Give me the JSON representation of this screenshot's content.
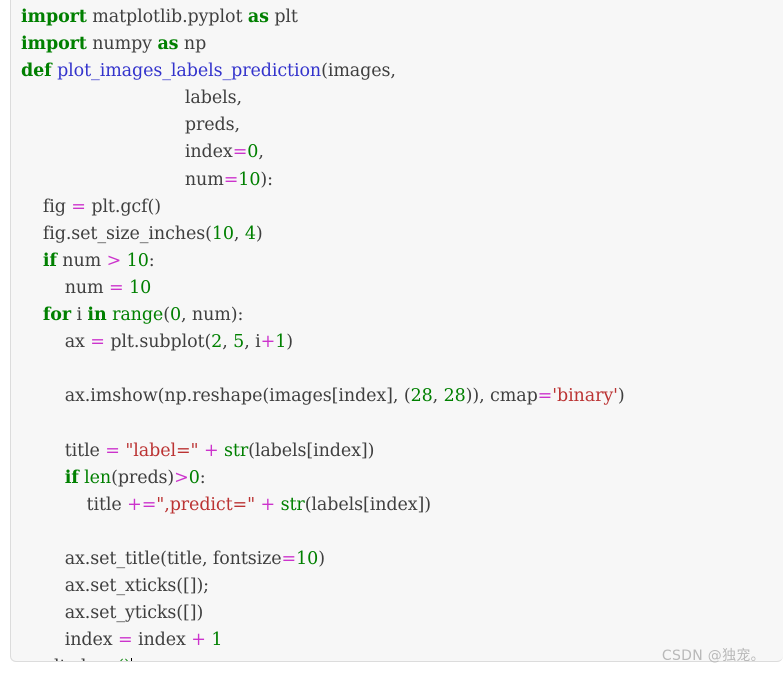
{
  "editor": {
    "language": "python",
    "background_color": "#f7f7f7",
    "border_color": "#dcdcdc",
    "default_text_color": "#3f3f3f",
    "syntax_colors": {
      "keyword": "#008000",
      "builtin": "#008000",
      "function_name": "#3333cc",
      "number": "#008000",
      "string": "#bb3333",
      "operator": "#cc33cc",
      "plain": "#3f3f3f"
    },
    "lines": [
      {
        "indent": 0,
        "tokens": [
          {
            "t": "import",
            "c": "kw"
          },
          {
            "t": " matplotlib.pyplot ",
            "c": "pl"
          },
          {
            "t": "as",
            "c": "kw"
          },
          {
            "t": " plt",
            "c": "pl"
          }
        ]
      },
      {
        "indent": 0,
        "tokens": [
          {
            "t": "import",
            "c": "kw"
          },
          {
            "t": " numpy ",
            "c": "pl"
          },
          {
            "t": "as",
            "c": "kw"
          },
          {
            "t": " np",
            "c": "pl"
          }
        ]
      },
      {
        "indent": 0,
        "tokens": [
          {
            "t": "def",
            "c": "kw"
          },
          {
            "t": " ",
            "c": "pl"
          },
          {
            "t": "plot_images_labels_prediction",
            "c": "fn"
          },
          {
            "t": "(images,",
            "c": "pl"
          }
        ]
      },
      {
        "indent": 0,
        "tokens": [
          {
            "t": "                              labels,",
            "c": "pl"
          }
        ]
      },
      {
        "indent": 0,
        "tokens": [
          {
            "t": "                              preds,",
            "c": "pl"
          }
        ]
      },
      {
        "indent": 0,
        "tokens": [
          {
            "t": "                              index",
            "c": "pl"
          },
          {
            "t": "=",
            "c": "op"
          },
          {
            "t": "0",
            "c": "num"
          },
          {
            "t": ",",
            "c": "pl"
          }
        ]
      },
      {
        "indent": 0,
        "tokens": [
          {
            "t": "                              num",
            "c": "pl"
          },
          {
            "t": "=",
            "c": "op"
          },
          {
            "t": "10",
            "c": "num"
          },
          {
            "t": "):",
            "c": "pl"
          }
        ]
      },
      {
        "indent": 0,
        "tokens": [
          {
            "t": "    fig ",
            "c": "pl"
          },
          {
            "t": "=",
            "c": "op"
          },
          {
            "t": " plt.gcf()",
            "c": "pl"
          }
        ]
      },
      {
        "indent": 0,
        "tokens": [
          {
            "t": "    fig.set_size_inches(",
            "c": "pl"
          },
          {
            "t": "10",
            "c": "num"
          },
          {
            "t": ", ",
            "c": "pl"
          },
          {
            "t": "4",
            "c": "num"
          },
          {
            "t": ")",
            "c": "pl"
          }
        ]
      },
      {
        "indent": 0,
        "tokens": [
          {
            "t": "    ",
            "c": "pl"
          },
          {
            "t": "if",
            "c": "kw"
          },
          {
            "t": " num ",
            "c": "pl"
          },
          {
            "t": ">",
            "c": "op"
          },
          {
            "t": " ",
            "c": "pl"
          },
          {
            "t": "10",
            "c": "num"
          },
          {
            "t": ":",
            "c": "pl"
          }
        ]
      },
      {
        "indent": 0,
        "tokens": [
          {
            "t": "        num ",
            "c": "pl"
          },
          {
            "t": "=",
            "c": "op"
          },
          {
            "t": " ",
            "c": "pl"
          },
          {
            "t": "10",
            "c": "num"
          }
        ]
      },
      {
        "indent": 0,
        "tokens": [
          {
            "t": "    ",
            "c": "pl"
          },
          {
            "t": "for",
            "c": "kw"
          },
          {
            "t": " i ",
            "c": "pl"
          },
          {
            "t": "in",
            "c": "kw"
          },
          {
            "t": " ",
            "c": "pl"
          },
          {
            "t": "range",
            "c": "bi"
          },
          {
            "t": "(",
            "c": "pl"
          },
          {
            "t": "0",
            "c": "num"
          },
          {
            "t": ", num):",
            "c": "pl"
          }
        ]
      },
      {
        "indent": 0,
        "tokens": [
          {
            "t": "        ax ",
            "c": "pl"
          },
          {
            "t": "=",
            "c": "op"
          },
          {
            "t": " plt.subplot(",
            "c": "pl"
          },
          {
            "t": "2",
            "c": "num"
          },
          {
            "t": ", ",
            "c": "pl"
          },
          {
            "t": "5",
            "c": "num"
          },
          {
            "t": ", i",
            "c": "pl"
          },
          {
            "t": "+",
            "c": "op"
          },
          {
            "t": "1",
            "c": "num"
          },
          {
            "t": ")",
            "c": "pl"
          }
        ]
      },
      {
        "indent": 0,
        "tokens": []
      },
      {
        "indent": 0,
        "tokens": [
          {
            "t": "        ax.imshow(np.reshape(images[index], (",
            "c": "pl"
          },
          {
            "t": "28",
            "c": "num"
          },
          {
            "t": ", ",
            "c": "pl"
          },
          {
            "t": "28",
            "c": "num"
          },
          {
            "t": ")), cmap",
            "c": "pl"
          },
          {
            "t": "=",
            "c": "op"
          },
          {
            "t": "'binary'",
            "c": "str"
          },
          {
            "t": ")",
            "c": "pl"
          }
        ]
      },
      {
        "indent": 0,
        "tokens": []
      },
      {
        "indent": 0,
        "tokens": [
          {
            "t": "        title ",
            "c": "pl"
          },
          {
            "t": "=",
            "c": "op"
          },
          {
            "t": " ",
            "c": "pl"
          },
          {
            "t": "\"label=\"",
            "c": "str"
          },
          {
            "t": " ",
            "c": "pl"
          },
          {
            "t": "+",
            "c": "op"
          },
          {
            "t": " ",
            "c": "pl"
          },
          {
            "t": "str",
            "c": "bi"
          },
          {
            "t": "(labels[index])",
            "c": "pl"
          }
        ]
      },
      {
        "indent": 0,
        "tokens": [
          {
            "t": "        ",
            "c": "pl"
          },
          {
            "t": "if",
            "c": "kw"
          },
          {
            "t": " ",
            "c": "pl"
          },
          {
            "t": "len",
            "c": "bi"
          },
          {
            "t": "(preds)",
            "c": "pl"
          },
          {
            "t": ">",
            "c": "op"
          },
          {
            "t": "0",
            "c": "num"
          },
          {
            "t": ":",
            "c": "pl"
          }
        ]
      },
      {
        "indent": 0,
        "tokens": [
          {
            "t": "            title ",
            "c": "pl"
          },
          {
            "t": "+=",
            "c": "op"
          },
          {
            "t": "\",predict=\"",
            "c": "str"
          },
          {
            "t": " ",
            "c": "pl"
          },
          {
            "t": "+",
            "c": "op"
          },
          {
            "t": " ",
            "c": "pl"
          },
          {
            "t": "str",
            "c": "bi"
          },
          {
            "t": "(labels[index])",
            "c": "pl"
          }
        ]
      },
      {
        "indent": 0,
        "tokens": []
      },
      {
        "indent": 0,
        "tokens": [
          {
            "t": "        ax.set_title(title, fontsize",
            "c": "pl"
          },
          {
            "t": "=",
            "c": "op"
          },
          {
            "t": "10",
            "c": "num"
          },
          {
            "t": ")",
            "c": "pl"
          }
        ]
      },
      {
        "indent": 0,
        "tokens": [
          {
            "t": "        ax.set_xticks([]);",
            "c": "pl"
          }
        ]
      },
      {
        "indent": 0,
        "tokens": [
          {
            "t": "        ax.set_yticks([])",
            "c": "pl"
          }
        ]
      },
      {
        "indent": 0,
        "tokens": [
          {
            "t": "        index ",
            "c": "pl"
          },
          {
            "t": "=",
            "c": "op"
          },
          {
            "t": " index ",
            "c": "pl"
          },
          {
            "t": "+",
            "c": "op"
          },
          {
            "t": " ",
            "c": "pl"
          },
          {
            "t": "1",
            "c": "num"
          }
        ]
      },
      {
        "indent": 0,
        "tokens": [
          {
            "t": "    plt.show",
            "c": "pl"
          },
          {
            "t": "()",
            "c": "bi"
          },
          {
            "t": "",
            "c": "cursor"
          }
        ]
      }
    ],
    "plain_text": "import matplotlib.pyplot as plt\nimport numpy as np\ndef plot_images_labels_prediction(images,\n                              labels,\n                              preds,\n                              index=0,\n                              num=10):\n    fig = plt.gcf()\n    fig.set_size_inches(10,4)\n    if num > 10:\n        num = 10\n    for i in range(0,num):\n        ax = plt.subplot(2,5,i+1)\n\n        ax.imshow(np.reshape(images[index],(28,28)),cmap='binary')\n\n        title = \"label=\" + str(labels[index])\n        if len(preds)>0:\n            title +=\",predict=\" + str(labels[index])\n\n        ax.set_title(title,fontsize=10)\n        ax.set_xticks([]);\n        ax.set_yticks([])\n        index = index + 1\n    plt.show()"
  },
  "watermark": {
    "text": "CSDN @独宠。",
    "color": "#b9b9b9"
  }
}
